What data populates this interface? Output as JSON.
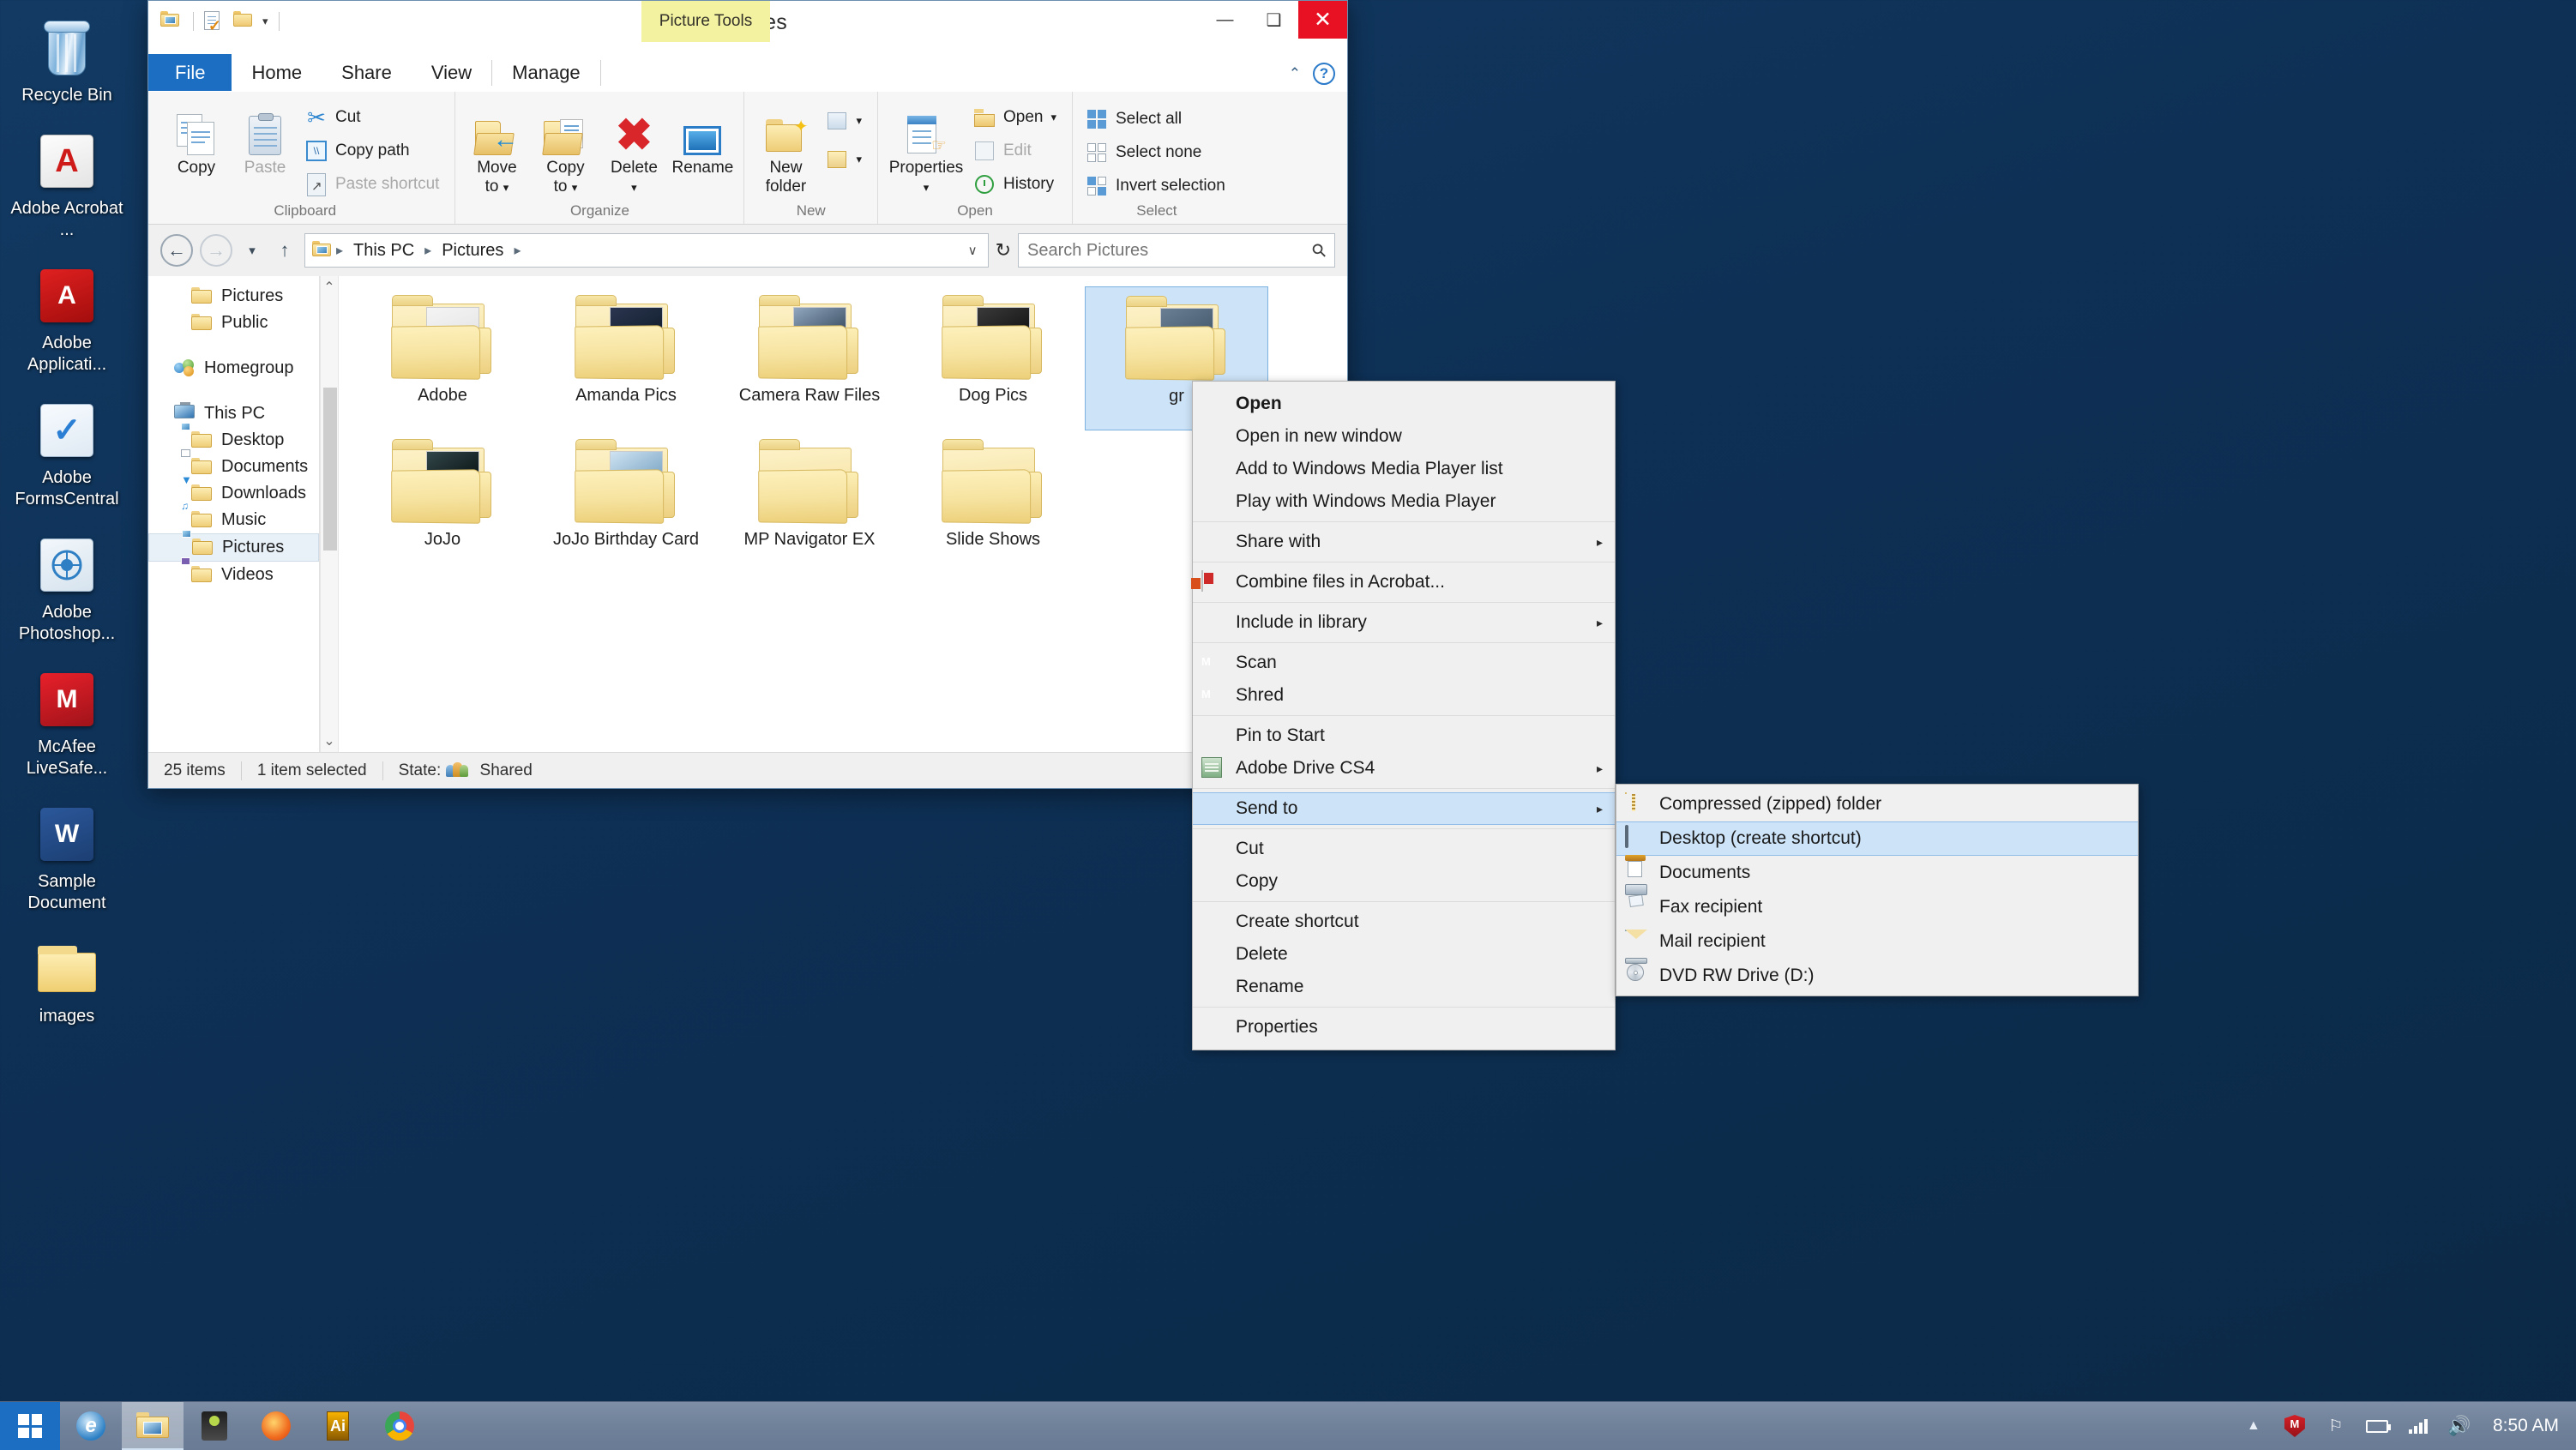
{
  "window": {
    "title": "Pictures",
    "contextual_tab_group": "Picture Tools",
    "quick_access": [
      "pictures-folder-icon",
      "properties-icon",
      "new-folder-icon",
      "customize-caret"
    ],
    "caption_buttons": {
      "minimize": "—",
      "maximize": "❑",
      "close": "✕"
    }
  },
  "tabs": [
    {
      "id": "file",
      "label": "File"
    },
    {
      "id": "home",
      "label": "Home"
    },
    {
      "id": "share",
      "label": "Share"
    },
    {
      "id": "view",
      "label": "View"
    },
    {
      "id": "manage",
      "label": "Manage"
    }
  ],
  "ribbon_right": {
    "collapse": "⌃",
    "help": "?"
  },
  "ribbon": {
    "groups": [
      {
        "name": "Clipboard",
        "big_buttons": [
          {
            "label": "Copy",
            "icon": "copy-icon",
            "disabled": false
          },
          {
            "label": "Paste",
            "icon": "paste-icon",
            "disabled": true
          }
        ],
        "small_buttons": [
          {
            "label": "Cut",
            "icon": "scissors-icon",
            "disabled": false
          },
          {
            "label": "Copy path",
            "icon": "copy-path-icon",
            "disabled": false
          },
          {
            "label": "Paste shortcut",
            "icon": "paste-shortcut-icon",
            "disabled": true
          }
        ]
      },
      {
        "name": "Organize",
        "big_buttons": [
          {
            "label": "Move",
            "label2": "to",
            "icon": "move-to-icon",
            "has_dropdown": true
          },
          {
            "label": "Copy",
            "label2": "to",
            "icon": "copy-to-icon",
            "has_dropdown": true
          },
          {
            "label": "Delete",
            "icon": "delete-icon",
            "has_dropdown": true
          },
          {
            "label": "Rename",
            "icon": "rename-icon",
            "has_dropdown": false
          }
        ]
      },
      {
        "name": "New",
        "big_buttons": [
          {
            "label": "New",
            "label2": "folder",
            "icon": "new-folder-icon"
          }
        ],
        "split_buttons": [
          "new-item-icon",
          "easy-access-icon"
        ]
      },
      {
        "name": "Open",
        "big_buttons": [
          {
            "label": "Properties",
            "icon": "properties-icon",
            "has_dropdown": true
          }
        ],
        "small_buttons": [
          {
            "label": "Open",
            "icon": "open-icon",
            "has_dropdown": true,
            "disabled": false
          },
          {
            "label": "Edit",
            "icon": "edit-icon",
            "disabled": true
          },
          {
            "label": "History",
            "icon": "history-icon",
            "disabled": false
          }
        ]
      },
      {
        "name": "Select",
        "small_buttons": [
          {
            "label": "Select all",
            "icon": "select-all-icon"
          },
          {
            "label": "Select none",
            "icon": "select-none-icon"
          },
          {
            "label": "Invert selection",
            "icon": "invert-selection-icon"
          }
        ]
      }
    ]
  },
  "address": {
    "back": "←",
    "forward": "→",
    "recent_caret": "▾",
    "up": "↑",
    "crumbs": [
      "This PC",
      "Pictures"
    ],
    "dropdown_caret": "∨",
    "refresh": "↻"
  },
  "search": {
    "placeholder": "Search Pictures",
    "value": "",
    "icon": "search-icon"
  },
  "navpane": {
    "items": [
      {
        "label": "Pictures",
        "icon": "folder-icon",
        "indent": true,
        "selected": false
      },
      {
        "label": "Public",
        "icon": "folder-icon",
        "indent": true,
        "selected": false
      },
      {
        "label": "Homegroup",
        "icon": "homegroup-icon",
        "indent": false,
        "selected": false
      },
      {
        "label": "This PC",
        "icon": "this-pc-icon",
        "indent": false,
        "selected": false
      },
      {
        "label": "Desktop",
        "icon": "desktop-folder-icon",
        "indent": true,
        "selected": false
      },
      {
        "label": "Documents",
        "icon": "documents-folder-icon",
        "indent": true,
        "selected": false
      },
      {
        "label": "Downloads",
        "icon": "downloads-folder-icon",
        "indent": true,
        "selected": false
      },
      {
        "label": "Music",
        "icon": "music-folder-icon",
        "indent": true,
        "selected": false
      },
      {
        "label": "Pictures",
        "icon": "pictures-folder-icon",
        "indent": true,
        "selected": true
      },
      {
        "label": "Videos",
        "icon": "videos-folder-icon",
        "indent": true,
        "selected": false
      }
    ],
    "scroll_up": "⌃",
    "scroll_down": "⌄"
  },
  "files": [
    {
      "name": "Adobe",
      "type": "folder",
      "selected": false,
      "has_preview": true
    },
    {
      "name": "Amanda Pics",
      "type": "folder",
      "selected": false,
      "has_preview": true
    },
    {
      "name": "Camera Raw Files",
      "type": "folder",
      "selected": false,
      "has_preview": true
    },
    {
      "name": "Dog Pics",
      "type": "folder",
      "selected": false,
      "has_preview": true
    },
    {
      "name": "gr",
      "type": "folder",
      "selected": true,
      "has_preview": true
    },
    {
      "name": "",
      "type": "folder",
      "selected": false,
      "has_preview": true
    },
    {
      "name": "JoJo",
      "type": "folder",
      "selected": false,
      "has_preview": true
    },
    {
      "name": "JoJo Birthday Card",
      "type": "folder",
      "selected": false,
      "has_preview": true
    },
    {
      "name": "MP Navigator EX",
      "type": "folder",
      "selected": false,
      "has_preview": false
    },
    {
      "name": "Slide Shows",
      "type": "folder",
      "selected": false,
      "has_preview": false
    },
    {
      "name": "",
      "type": "folder",
      "selected": false,
      "has_preview": true
    }
  ],
  "statusbar": {
    "item_count": "25 items",
    "selection": "1 item selected",
    "state_label": "State:",
    "state_value": "Shared",
    "state_icon": "shared-people-icon"
  },
  "context_menu": {
    "sections": [
      {
        "items": [
          {
            "label": "Open",
            "bold": true,
            "icon": null,
            "submenu": false,
            "highlighted": false
          },
          {
            "label": "Open in new window",
            "bold": false,
            "icon": null,
            "submenu": false,
            "highlighted": false
          },
          {
            "label": "Add to Windows Media Player list",
            "bold": false,
            "icon": null,
            "submenu": false,
            "highlighted": false
          },
          {
            "label": "Play with Windows Media Player",
            "bold": false,
            "icon": null,
            "submenu": false,
            "highlighted": false
          }
        ]
      },
      {
        "items": [
          {
            "label": "Share with",
            "bold": false,
            "icon": null,
            "submenu": true,
            "highlighted": false
          }
        ]
      },
      {
        "items": [
          {
            "label": "Combine files in Acrobat...",
            "bold": false,
            "icon": "acrobat-icon",
            "submenu": false,
            "highlighted": false
          }
        ]
      },
      {
        "items": [
          {
            "label": "Include in library",
            "bold": false,
            "icon": null,
            "submenu": true,
            "highlighted": false
          }
        ]
      },
      {
        "items": [
          {
            "label": "Scan",
            "bold": false,
            "icon": "mcafee-shield-icon",
            "submenu": false,
            "highlighted": false
          },
          {
            "label": "Shred",
            "bold": false,
            "icon": "mcafee-shield-icon",
            "submenu": false,
            "highlighted": false
          }
        ]
      },
      {
        "items": [
          {
            "label": "Pin to Start",
            "bold": false,
            "icon": null,
            "submenu": false,
            "highlighted": false
          },
          {
            "label": "Adobe Drive CS4",
            "bold": false,
            "icon": "adobe-drive-icon",
            "submenu": true,
            "highlighted": false
          }
        ]
      },
      {
        "items": [
          {
            "label": "Send to",
            "bold": false,
            "icon": null,
            "submenu": true,
            "highlighted": true
          }
        ]
      },
      {
        "items": [
          {
            "label": "Cut",
            "bold": false,
            "icon": null,
            "submenu": false,
            "highlighted": false
          },
          {
            "label": "Copy",
            "bold": false,
            "icon": null,
            "submenu": false,
            "highlighted": false
          }
        ]
      },
      {
        "items": [
          {
            "label": "Create shortcut",
            "bold": false,
            "icon": null,
            "submenu": false,
            "highlighted": false
          },
          {
            "label": "Delete",
            "bold": false,
            "icon": null,
            "submenu": false,
            "highlighted": false
          },
          {
            "label": "Rename",
            "bold": false,
            "icon": null,
            "submenu": false,
            "highlighted": false
          }
        ]
      },
      {
        "items": [
          {
            "label": "Properties",
            "bold": false,
            "icon": null,
            "submenu": false,
            "highlighted": false
          }
        ]
      }
    ],
    "submenu_arrow": "▸"
  },
  "send_to_submenu": {
    "items": [
      {
        "label": "Compressed (zipped) folder",
        "icon": "zip-folder-icon",
        "highlighted": false
      },
      {
        "label": "Desktop (create shortcut)",
        "icon": "desktop-icon",
        "highlighted": true
      },
      {
        "label": "Documents",
        "icon": "documents-icon",
        "highlighted": false
      },
      {
        "label": "Fax recipient",
        "icon": "fax-icon",
        "highlighted": false
      },
      {
        "label": "Mail recipient",
        "icon": "mail-icon",
        "highlighted": false
      },
      {
        "label": "DVD RW Drive (D:)",
        "icon": "dvd-drive-icon",
        "highlighted": false
      }
    ]
  },
  "desktop_icons": [
    {
      "label": "Recycle Bin",
      "icon": "recycle-bin-icon"
    },
    {
      "label": "Adobe Acrobat ...",
      "icon": "adobe-acrobat-icon"
    },
    {
      "label": "Adobe Applicati...",
      "icon": "adobe-application-icon"
    },
    {
      "label": "Adobe FormsCentral",
      "icon": "adobe-formscentral-icon"
    },
    {
      "label": "Adobe Photoshop...",
      "icon": "adobe-photoshop-icon"
    },
    {
      "label": "McAfee LiveSafe...",
      "icon": "mcafee-livesafe-icon"
    },
    {
      "label": "Sample Document",
      "icon": "word-document-icon"
    },
    {
      "label": "images",
      "icon": "folder-icon"
    }
  ],
  "taskbar": {
    "start": {
      "label": "Start",
      "icon": "windows-logo-icon"
    },
    "apps": [
      {
        "name": "internet-explorer",
        "active": false
      },
      {
        "name": "file-explorer",
        "active": true
      },
      {
        "name": "pen-app",
        "active": false
      },
      {
        "name": "firefox",
        "active": false
      },
      {
        "name": "adobe-illustrator",
        "active": false
      },
      {
        "name": "chrome",
        "active": false
      }
    ],
    "tray": [
      {
        "name": "show-hidden-icons",
        "glyph": "▲"
      },
      {
        "name": "mcafee-tray-icon"
      },
      {
        "name": "action-center-flag-icon"
      },
      {
        "name": "battery-icon"
      },
      {
        "name": "network-icon"
      },
      {
        "name": "volume-icon"
      }
    ],
    "clock": "8:50 AM"
  }
}
